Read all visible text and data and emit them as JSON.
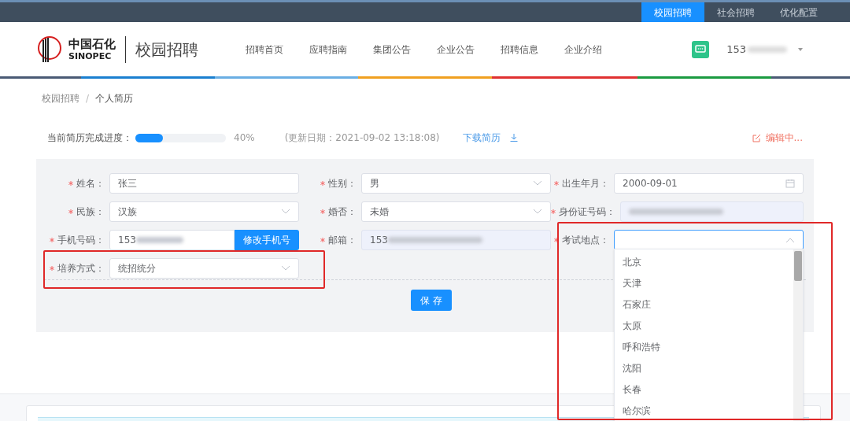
{
  "top_bar": {
    "tabs": [
      {
        "label": "校园招聘",
        "selected": true
      },
      {
        "label": "社会招聘",
        "selected": false
      },
      {
        "label": "优化配置",
        "selected": false
      }
    ]
  },
  "header": {
    "logo_cn": "中国石化",
    "logo_en": "SINOPEC",
    "site_title": "校园招聘",
    "nav": [
      "招聘首页",
      "应聘指南",
      "集团公告",
      "企业公告",
      "招聘信息",
      "企业介绍"
    ],
    "user": "153"
  },
  "breadcrumb": {
    "items": [
      "校园招聘",
      "个人简历"
    ],
    "separator": "/"
  },
  "progress": {
    "label": "当前简历完成进度：",
    "level": 0.3,
    "reading": "40%",
    "updated": "(更新日期：2021-09-02 13:18:08)",
    "download": "下载简历",
    "editing": "编辑中..."
  },
  "form": {
    "fields": [
      {
        "label": "姓名：",
        "kind": "text",
        "value": "张三",
        "required": true
      },
      {
        "label": "性别：",
        "kind": "select",
        "value": "男",
        "required": true
      },
      {
        "label": "出生年月：",
        "kind": "date",
        "value": "2000-09-01",
        "required": true
      },
      {
        "label": "民族：",
        "kind": "select",
        "value": "汉族",
        "required": true
      },
      {
        "label": "婚否：",
        "kind": "select",
        "value": "未婚",
        "required": true
      },
      {
        "label": "身份证号码：",
        "kind": "masked",
        "required": true
      },
      {
        "label": "手机号码：",
        "kind": "phone",
        "value": "153",
        "button": "修改手机号",
        "required": true
      },
      {
        "label": "邮箱：",
        "kind": "masked",
        "value": "153",
        "required": true
      },
      {
        "label": "考试地点：",
        "kind": "open-select",
        "required": true,
        "highlighted": true
      },
      {
        "label": "培养方式：",
        "kind": "select",
        "value": "统招统分",
        "required": true,
        "highlighted": true
      }
    ],
    "save": "保 存"
  },
  "dropdown": {
    "options": [
      "北京",
      "天津",
      "石家庄",
      "太原",
      "呼和浩特",
      "沈阳",
      "长春",
      "哈尔滨"
    ]
  }
}
